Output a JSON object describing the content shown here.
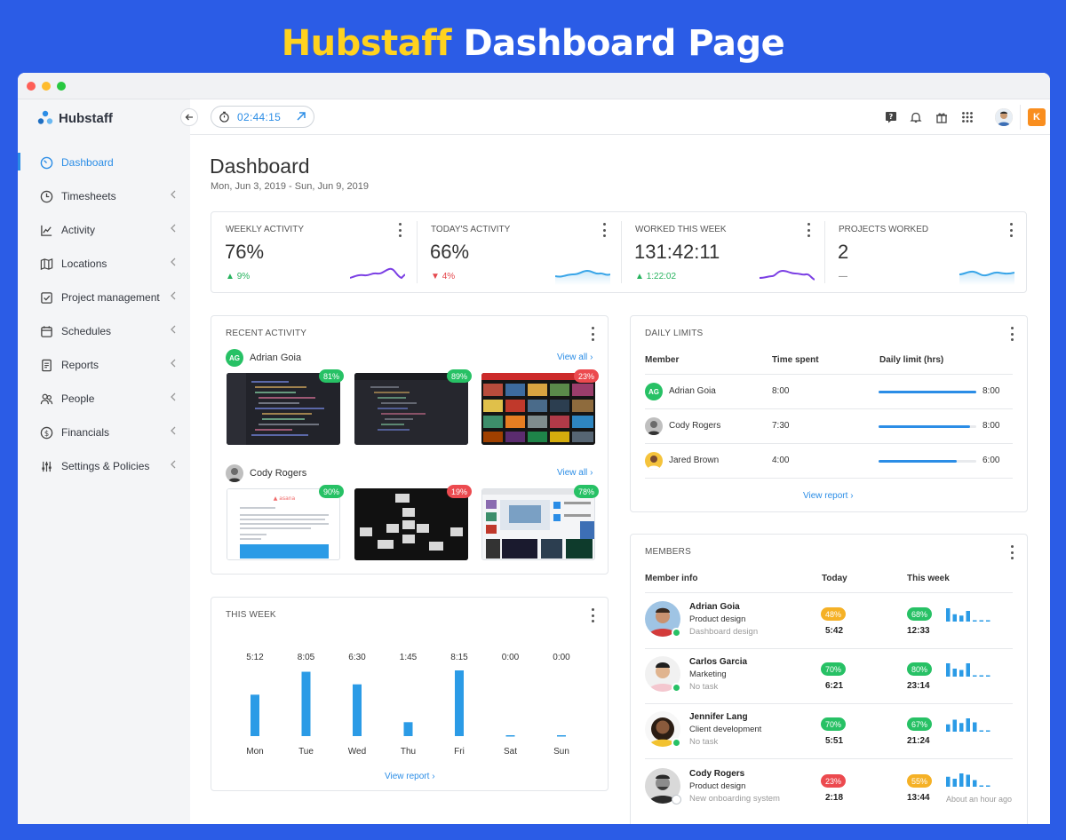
{
  "banner": {
    "brand": "Hubstaff",
    "rest": "Dashboard Page"
  },
  "sidebar": {
    "logo": "Hubstaff",
    "items": [
      {
        "label": "Dashboard"
      },
      {
        "label": "Timesheets"
      },
      {
        "label": "Activity"
      },
      {
        "label": "Locations"
      },
      {
        "label": "Project management"
      },
      {
        "label": "Schedules"
      },
      {
        "label": "Reports"
      },
      {
        "label": "People"
      },
      {
        "label": "Financials"
      },
      {
        "label": "Settings & Policies"
      }
    ]
  },
  "topbar": {
    "timer": "02:44:15",
    "org_initial": "K"
  },
  "page": {
    "title": "Dashboard",
    "date_range": "Mon, Jun 3, 2019 - Sun, Jun 9, 2019"
  },
  "stats": [
    {
      "label": "WEEKLY ACTIVITY",
      "value": "76%",
      "change": "9%",
      "direction": "up",
      "color": "#7b3fe4"
    },
    {
      "label": "TODAY'S ACTIVITY",
      "value": "66%",
      "change": "4%",
      "direction": "down",
      "color": "#39a5e8"
    },
    {
      "label": "WORKED THIS WEEK",
      "value": "131:42:11",
      "change": "1:22:02",
      "direction": "up",
      "color": "#7b3fe4"
    },
    {
      "label": "PROJECTS WORKED",
      "value": "2",
      "change": "—",
      "direction": "none",
      "color": "#39a5e8"
    }
  ],
  "recent": {
    "title": "RECENT ACTIVITY",
    "view_all": "View all",
    "people": [
      {
        "name": "Adrian Goia",
        "initials": "AG",
        "shots": [
          {
            "pct": "81%",
            "level": "green"
          },
          {
            "pct": "89%",
            "level": "green"
          },
          {
            "pct": "23%",
            "level": "red"
          }
        ]
      },
      {
        "name": "Cody Rogers",
        "initials": "",
        "shots": [
          {
            "pct": "90%",
            "level": "green"
          },
          {
            "pct": "19%",
            "level": "red"
          },
          {
            "pct": "78%",
            "level": "green"
          }
        ]
      }
    ]
  },
  "this_week": {
    "title": "THIS WEEK",
    "view_report": "View report",
    "chart_data": {
      "type": "bar",
      "categories": [
        "Mon",
        "Tue",
        "Wed",
        "Thu",
        "Fri",
        "Sat",
        "Sun"
      ],
      "labels": [
        "5:12",
        "8:05",
        "6:30",
        "1:45",
        "8:15",
        "0:00",
        "0:00"
      ],
      "values": [
        5.2,
        8.08,
        6.5,
        1.75,
        8.25,
        0,
        0
      ],
      "ylim": [
        0,
        8.25
      ],
      "color": "#2b9be6"
    }
  },
  "limits": {
    "title": "DAILY LIMITS",
    "headers": {
      "member": "Member",
      "spent": "Time spent",
      "limit": "Daily limit (hrs)"
    },
    "rows": [
      {
        "name": "Adrian Goia",
        "initials": "AG",
        "spent": "8:00",
        "limit": "8:00",
        "fraction": 1.0
      },
      {
        "name": "Cody Rogers",
        "initials": "",
        "spent": "7:30",
        "limit": "8:00",
        "fraction": 0.9375
      },
      {
        "name": "Jared Brown",
        "initials": "",
        "spent": "4:00",
        "limit": "6:00",
        "fraction": 0.8
      }
    ],
    "view_report": "View report"
  },
  "members": {
    "title": "MEMBERS",
    "headers": {
      "info": "Member info",
      "today": "Today",
      "week": "This week"
    },
    "rows": [
      {
        "name": "Adrian Goia",
        "role": "Product design",
        "task": "Dashboard design",
        "today_pct": "48%",
        "today_level": "yellow",
        "today_time": "5:42",
        "week_pct": "68%",
        "week_level": "green",
        "week_time": "12:33",
        "online": true,
        "note": "",
        "bars": [
          1.0,
          0.55,
          0.45,
          0.8,
          0.12,
          0.12,
          0.12
        ]
      },
      {
        "name": "Carlos Garcia",
        "role": "Marketing",
        "task": "No task",
        "today_pct": "70%",
        "today_level": "green",
        "today_time": "6:21",
        "week_pct": "80%",
        "week_level": "green",
        "week_time": "23:14",
        "online": true,
        "note": "",
        "bars": [
          1.0,
          0.6,
          0.5,
          1.0,
          0.12,
          0.12,
          0.12
        ]
      },
      {
        "name": "Jennifer Lang",
        "role": "Client development",
        "task": "No task",
        "today_pct": "70%",
        "today_level": "green",
        "today_time": "5:51",
        "week_pct": "67%",
        "week_level": "green",
        "week_time": "21:24",
        "online": true,
        "note": "",
        "bars": [
          0.55,
          0.9,
          0.65,
          1.0,
          0.7,
          0.12,
          0.12
        ]
      },
      {
        "name": "Cody Rogers",
        "role": "Product design",
        "task": "New onboarding system",
        "today_pct": "23%",
        "today_level": "red",
        "today_time": "2:18",
        "week_pct": "55%",
        "week_level": "yellow",
        "week_time": "13:44",
        "online": false,
        "note": "About an hour ago",
        "bars": [
          0.75,
          0.6,
          1.0,
          0.9,
          0.5,
          0.12,
          0.12
        ]
      }
    ]
  }
}
